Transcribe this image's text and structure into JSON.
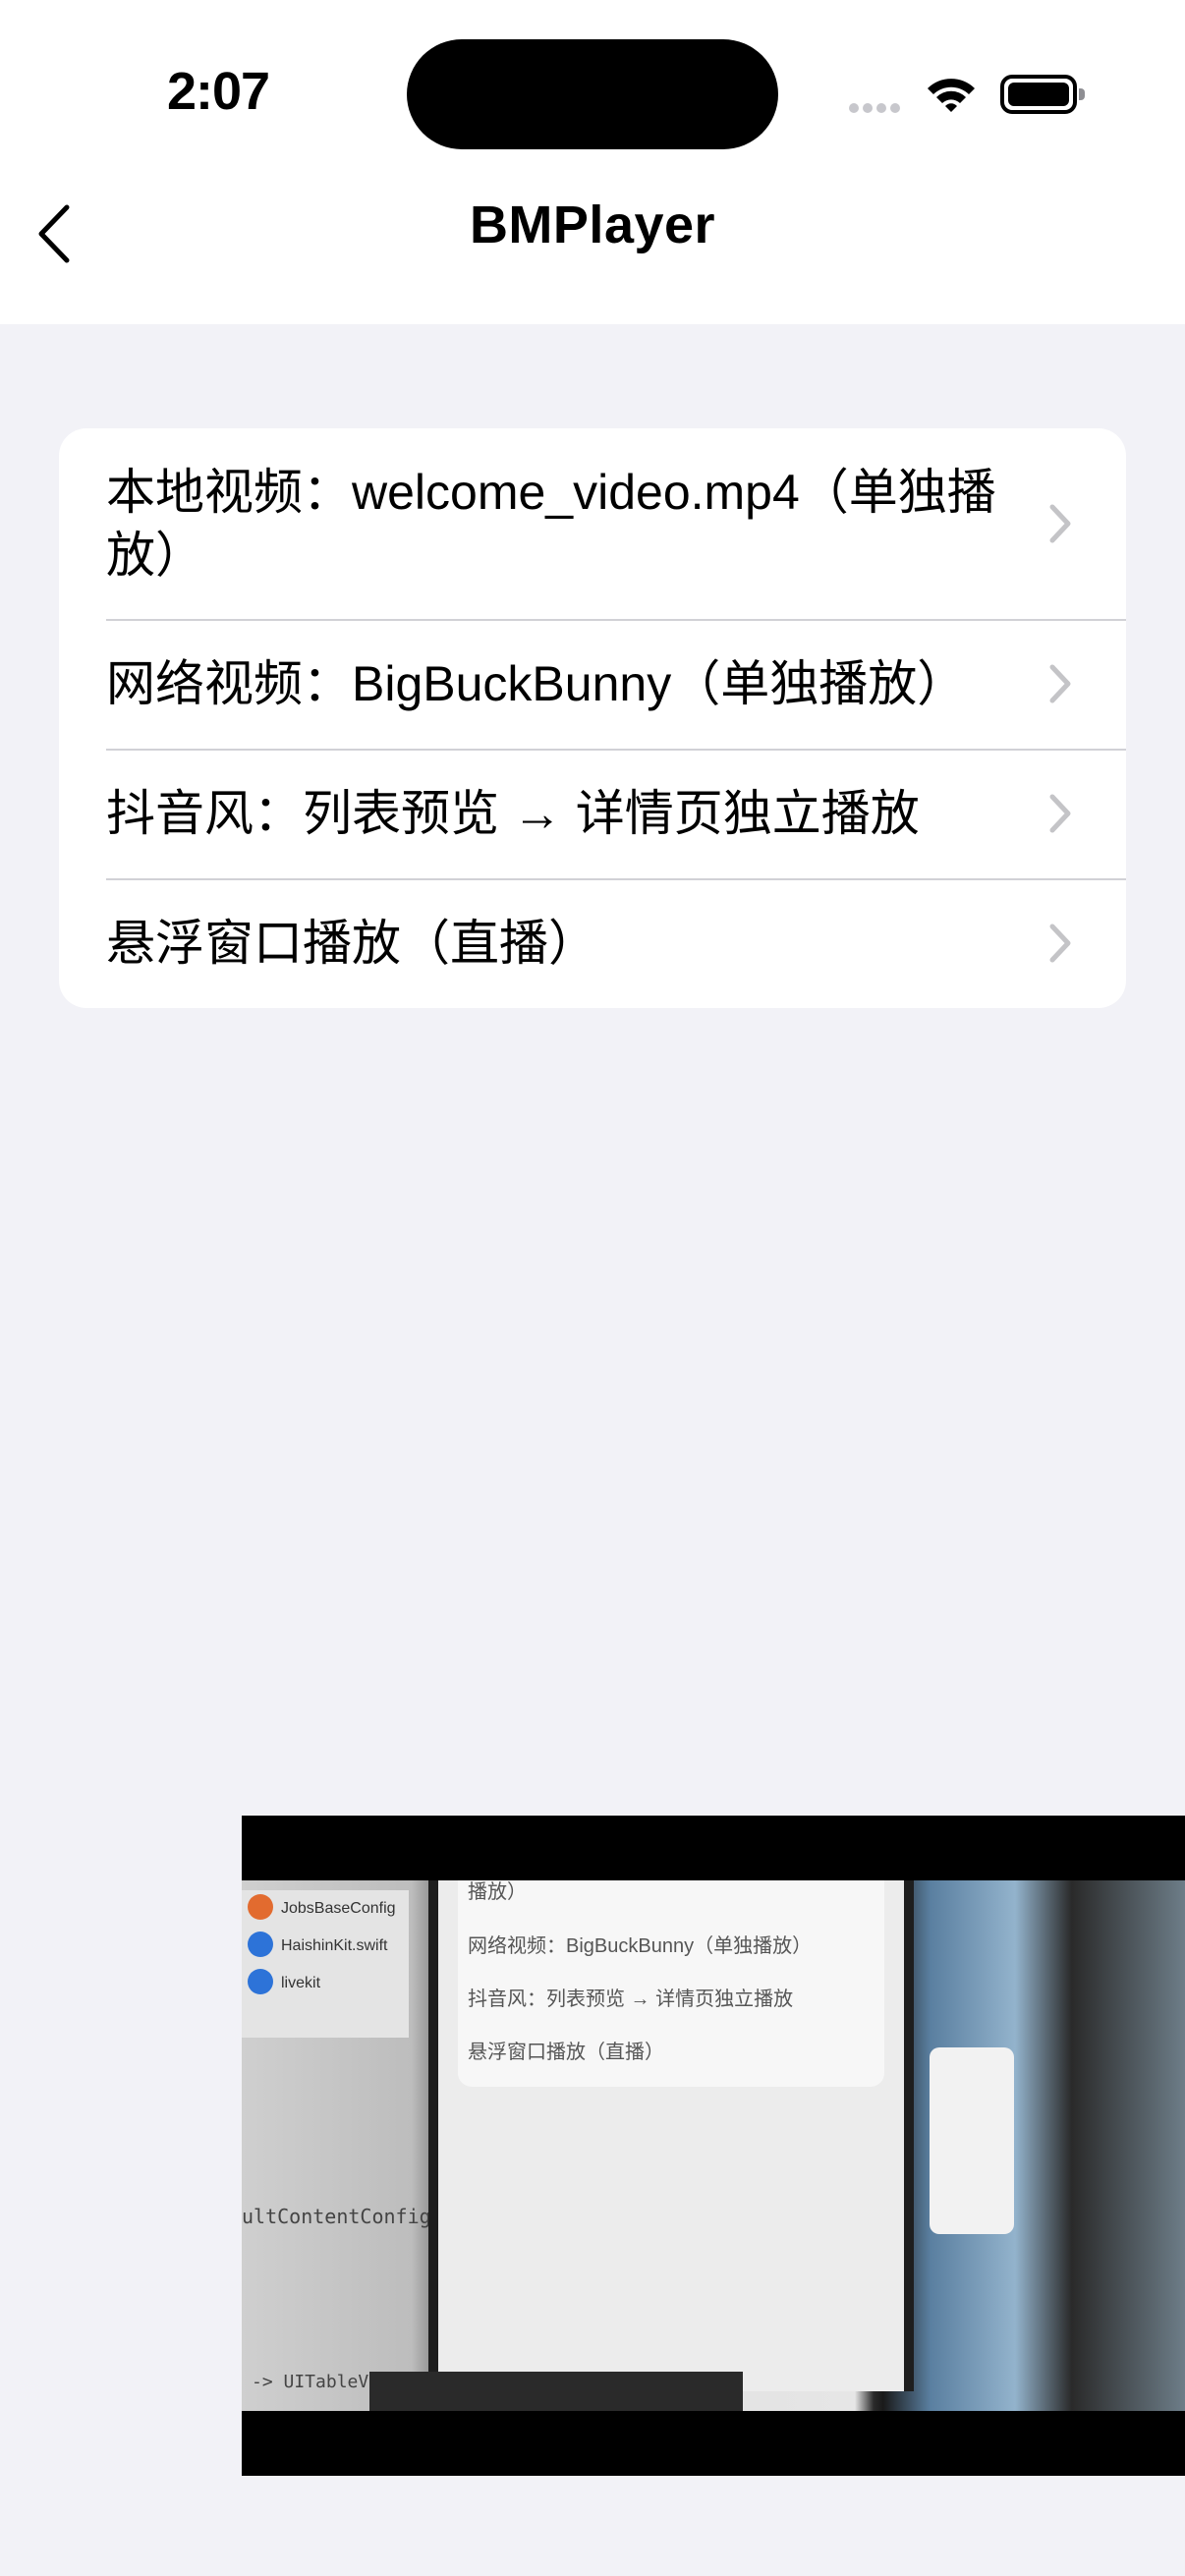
{
  "status_bar": {
    "time": "2:07"
  },
  "nav": {
    "title": "BMPlayer"
  },
  "menu": {
    "items": [
      {
        "label": "本地视频：welcome_video.mp4（单独播放）"
      },
      {
        "label": "网络视频：BigBuckBunny（单独播放）"
      },
      {
        "label": "抖音风：列表预览 → 详情页独立播放"
      },
      {
        "label": "悬浮窗口播放（直播）"
      }
    ]
  },
  "floating_video": {
    "sidebar_files": [
      "JobsBaseConfig",
      "HaishinKit.swift",
      "livekit"
    ],
    "code_lines": [
      "ultContentConfig",
      "-> UITableViewCe"
    ],
    "phone_rows": [
      "播放）",
      "网络视频：BigBuckBunny（单独播放）",
      "抖音风：列表预览 → 详情页独立播放",
      "悬浮窗口播放（直播）"
    ]
  },
  "colors": {
    "background": "#f2f2f7",
    "card": "#ffffff",
    "separator": "#d1d1d6",
    "chevron": "#c4c4c7"
  }
}
